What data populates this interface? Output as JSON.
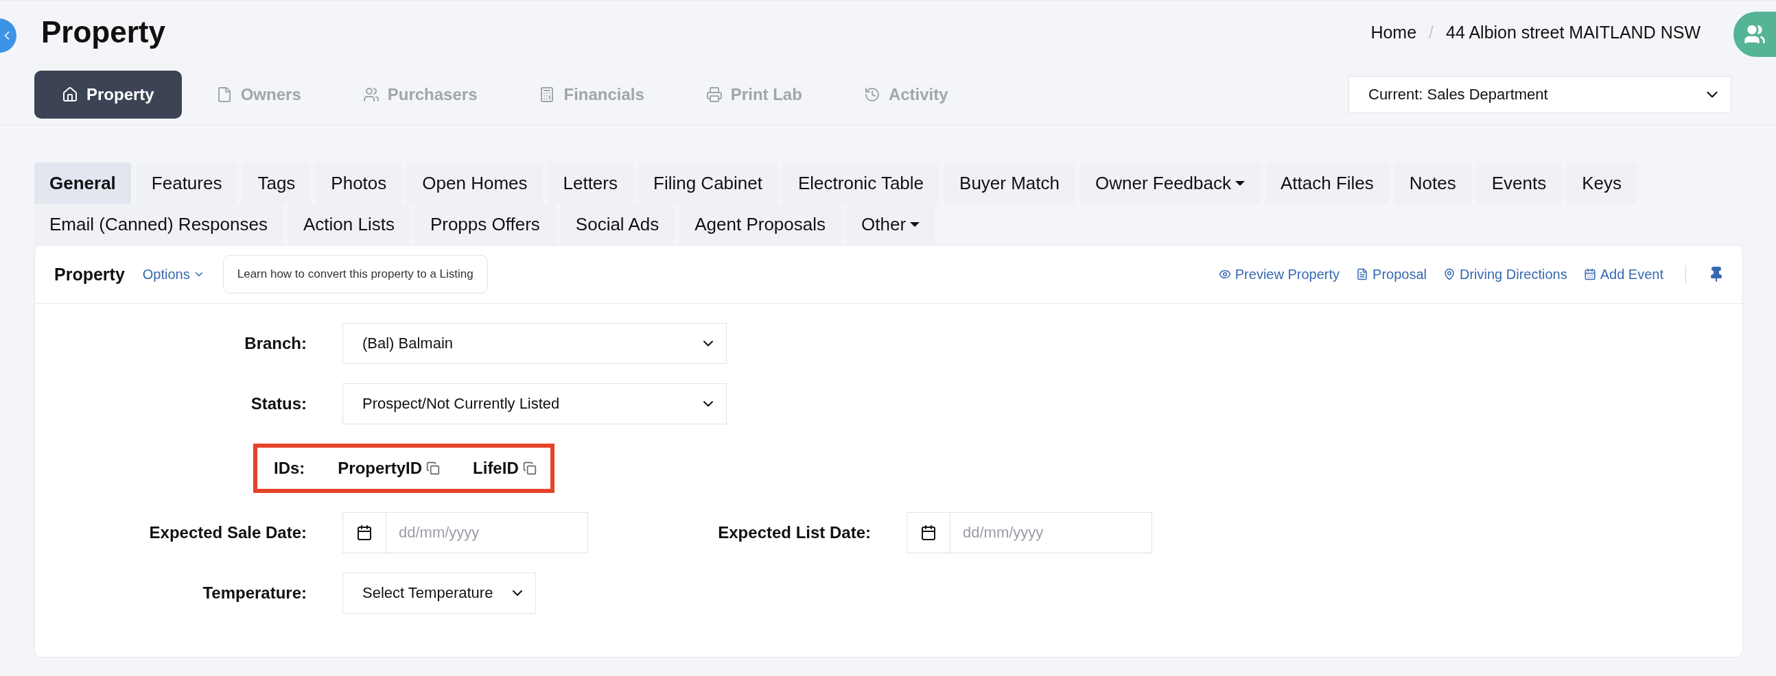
{
  "header": {
    "title": "Property",
    "breadcrumb": {
      "items": [
        "Home",
        "44 Albion street MAITLAND NSW"
      ],
      "separator": "/"
    }
  },
  "nav_tabs": [
    {
      "label": "Property",
      "kind": "home",
      "selected": true
    },
    {
      "label": "Owners",
      "kind": "file",
      "selected": false
    },
    {
      "label": "Purchasers",
      "kind": "users",
      "selected": false
    },
    {
      "label": "Financials",
      "kind": "calculator",
      "selected": false
    },
    {
      "label": "Print Lab",
      "kind": "printer",
      "selected": false
    },
    {
      "label": "Activity",
      "kind": "history",
      "selected": false
    }
  ],
  "department_select": {
    "value": "Current: Sales Department"
  },
  "section_tab_rows": [
    [
      {
        "label": "General",
        "selected": true,
        "dropdown": false
      },
      {
        "label": "Features",
        "selected": false,
        "dropdown": false
      },
      {
        "label": "Tags",
        "selected": false,
        "dropdown": false
      },
      {
        "label": "Photos",
        "selected": false,
        "dropdown": false
      },
      {
        "label": "Open Homes",
        "selected": false,
        "dropdown": false
      },
      {
        "label": "Letters",
        "selected": false,
        "dropdown": false
      },
      {
        "label": "Filing Cabinet",
        "selected": false,
        "dropdown": false
      },
      {
        "label": "Electronic Table",
        "selected": false,
        "dropdown": false
      },
      {
        "label": "Buyer Match",
        "selected": false,
        "dropdown": false
      },
      {
        "label": "Owner Feedback",
        "selected": false,
        "dropdown": true
      },
      {
        "label": "Attach Files",
        "selected": false,
        "dropdown": false
      },
      {
        "label": "Notes",
        "selected": false,
        "dropdown": false
      },
      {
        "label": "Events",
        "selected": false,
        "dropdown": false
      },
      {
        "label": "Keys",
        "selected": false,
        "dropdown": false
      }
    ],
    [
      {
        "label": "Email (Canned) Responses",
        "selected": false,
        "dropdown": false
      },
      {
        "label": "Action Lists",
        "selected": false,
        "dropdown": false
      },
      {
        "label": "Propps Offers",
        "selected": false,
        "dropdown": false
      },
      {
        "label": "Social Ads",
        "selected": false,
        "dropdown": false
      },
      {
        "label": "Agent Proposals",
        "selected": false,
        "dropdown": false
      },
      {
        "label": "Other",
        "selected": false,
        "dropdown": true
      }
    ]
  ],
  "card": {
    "title": "Property",
    "options": "Options",
    "help_button": "Learn how to convert this property to a Listing",
    "actions": [
      {
        "label": "Preview Property",
        "kind": "eye"
      },
      {
        "label": "Proposal",
        "kind": "file"
      },
      {
        "label": "Driving Directions",
        "kind": "pin"
      },
      {
        "label": "Add Event",
        "kind": "calendar"
      }
    ]
  },
  "form": {
    "branch": {
      "label": "Branch:",
      "value": "(Bal) Balmain"
    },
    "status": {
      "label": "Status:",
      "value": "Prospect/Not Currently Listed"
    },
    "ids": {
      "label": "IDs:",
      "items": [
        "PropertyID",
        "LifeID"
      ]
    },
    "expected_sale_date": {
      "label": "Expected Sale Date:",
      "placeholder": "dd/mm/yyyy"
    },
    "expected_list_date": {
      "label": "Expected List Date:",
      "placeholder": "dd/mm/yyyy"
    },
    "temperature": {
      "label": "Temperature:",
      "value": "Select Temperature"
    }
  }
}
